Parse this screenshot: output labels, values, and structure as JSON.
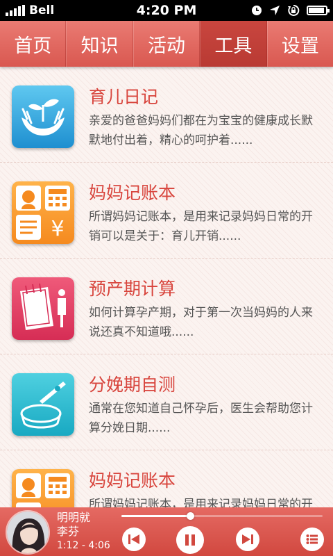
{
  "status_bar": {
    "carrier": "Bell",
    "time": "4:20 PM",
    "battery_level": 0.9
  },
  "nav": {
    "tabs": [
      {
        "label": "首页",
        "active": false
      },
      {
        "label": "知识",
        "active": false
      },
      {
        "label": "活动",
        "active": false
      },
      {
        "label": "工具",
        "active": true
      },
      {
        "label": "设置",
        "active": false
      }
    ]
  },
  "list": {
    "items": [
      {
        "title": "育儿日记",
        "desc": "亲爱的爸爸妈妈们都在为宝宝的健康成长默默地付出着，精心的呵护着......",
        "icon": "seedling-hands-icon"
      },
      {
        "title": "妈妈记账本",
        "desc": "所谓妈妈记账本，是用来记录妈妈日常的开销可以是关于：育儿开销......",
        "icon": "mom-account-book-icon"
      },
      {
        "title": "预产期计算",
        "desc": "如何计算孕产期，对于第一次当妈妈的人来说还真不知道哦......",
        "icon": "due-date-calendar-icon"
      },
      {
        "title": "分娩期自测",
        "desc": "通常在您知道自己怀孕后，医生会帮助您计算分娩日期......",
        "icon": "self-test-dish-icon"
      },
      {
        "title": "妈妈记账本",
        "desc": "所谓妈妈记账本，是用来记录妈妈日常的开销可以是关于：育儿开销......",
        "icon": "mom-account-book-icon"
      }
    ]
  },
  "player": {
    "song": "明明就",
    "artist": "李芬",
    "time": "1:12 - 4:06",
    "progress": 0.34
  },
  "colors": {
    "accent": "#d95850",
    "title": "#d8453d"
  }
}
